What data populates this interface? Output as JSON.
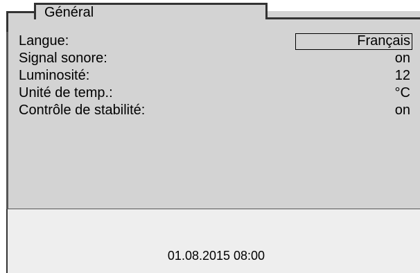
{
  "tab": {
    "title": "Général"
  },
  "settings": [
    {
      "label": "Langue:",
      "value": "Français",
      "selected": true
    },
    {
      "label": "Signal sonore:",
      "value": "on",
      "selected": false
    },
    {
      "label": "Luminosité:",
      "value": "12",
      "selected": false
    },
    {
      "label": "Unité de temp.:",
      "value": "°C",
      "selected": false
    },
    {
      "label": "Contrôle de stabilité:",
      "value": "on",
      "selected": false
    }
  ],
  "status": {
    "datetime": "01.08.2015 08:00"
  },
  "colors": {
    "panel_background": "#d3d3d3",
    "status_background": "#eeeeee",
    "border": "#333333"
  }
}
